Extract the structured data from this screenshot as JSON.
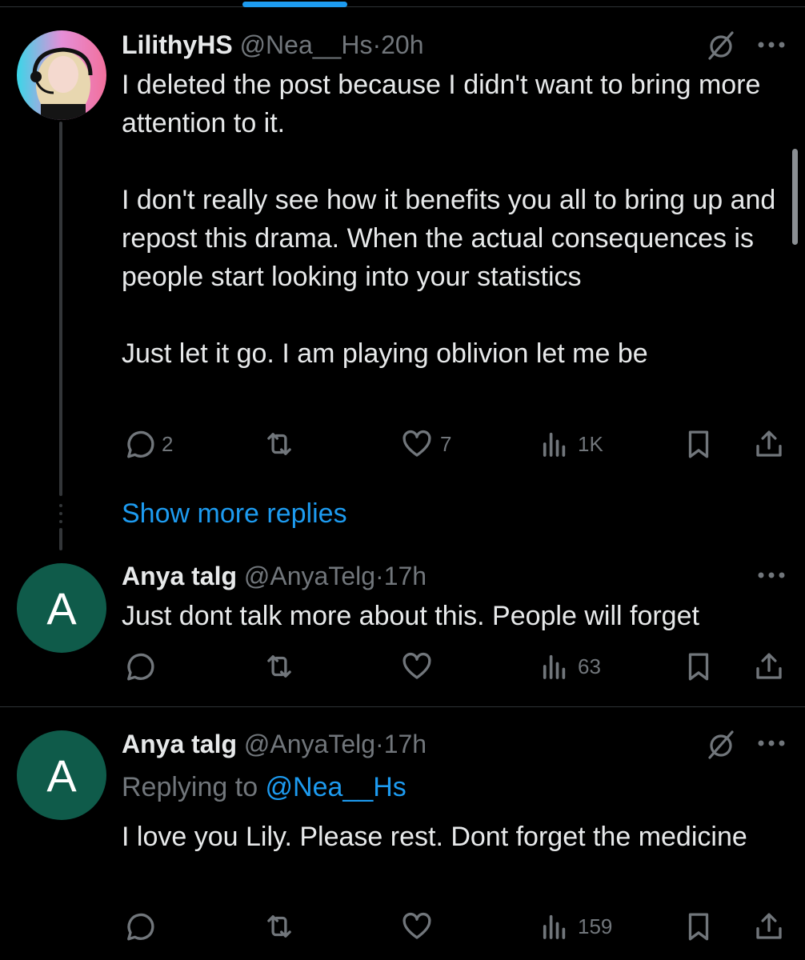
{
  "tweets": [
    {
      "name": "LilithyHS",
      "handle": "@Nea__Hs",
      "time": "20h",
      "text": "I deleted the post because I didn't want to bring more attention to it.\n\nI don't really see how it benefits you all to bring up and repost this drama. When the actual consequences is people start looking into your statistics\n\nJust let it go. I am playing oblivion let me be",
      "replies": "2",
      "retweets": "",
      "likes": "7",
      "views": "1K"
    },
    {
      "name": "Anya talg",
      "handle": "@AnyaTelg",
      "time": "17h",
      "avatar_letter": "A",
      "text": "Just dont talk more about this. People will forget",
      "replies": "",
      "retweets": "",
      "likes": "",
      "views": "63"
    },
    {
      "name": "Anya talg",
      "handle": "@AnyaTelg",
      "time": "17h",
      "avatar_letter": "A",
      "replying_to_prefix": "Replying to ",
      "replying_to_handle": "@Nea__Hs",
      "text": "I love you Lily. Please rest. Dont forget the medicine",
      "replies": "",
      "retweets": "",
      "likes": "",
      "views": "159"
    }
  ],
  "show_more_label": "Show more replies",
  "separator": "·",
  "icons": [
    "reply-icon",
    "retweet-icon",
    "like-icon",
    "views-icon",
    "bookmark-icon",
    "share-icon",
    "more-icon",
    "grok-icon"
  ],
  "colors": {
    "background": "#000000",
    "text": "#e7e9ea",
    "muted": "#71767b",
    "accent": "#1d9bf0",
    "avatar_green": "#0f5b4a"
  }
}
